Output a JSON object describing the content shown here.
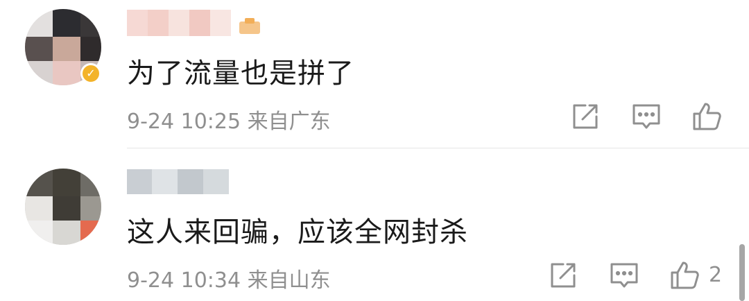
{
  "comments": [
    {
      "text": "为了流量也是拼了",
      "meta": "9-24 10:25 来自广东",
      "likes": ""
    },
    {
      "text": "这人来回骗，应该全网封杀",
      "meta": "9-24 10:34 来自山东",
      "likes": "2"
    }
  ],
  "icons": {
    "share": "share-icon",
    "reply": "comment-icon",
    "like": "thumbs-up-icon",
    "verified": "verified-badge-icon"
  },
  "colors": {
    "text": "#1a1a1a",
    "meta": "#8f8f8f",
    "badge": "#f3b32a"
  }
}
